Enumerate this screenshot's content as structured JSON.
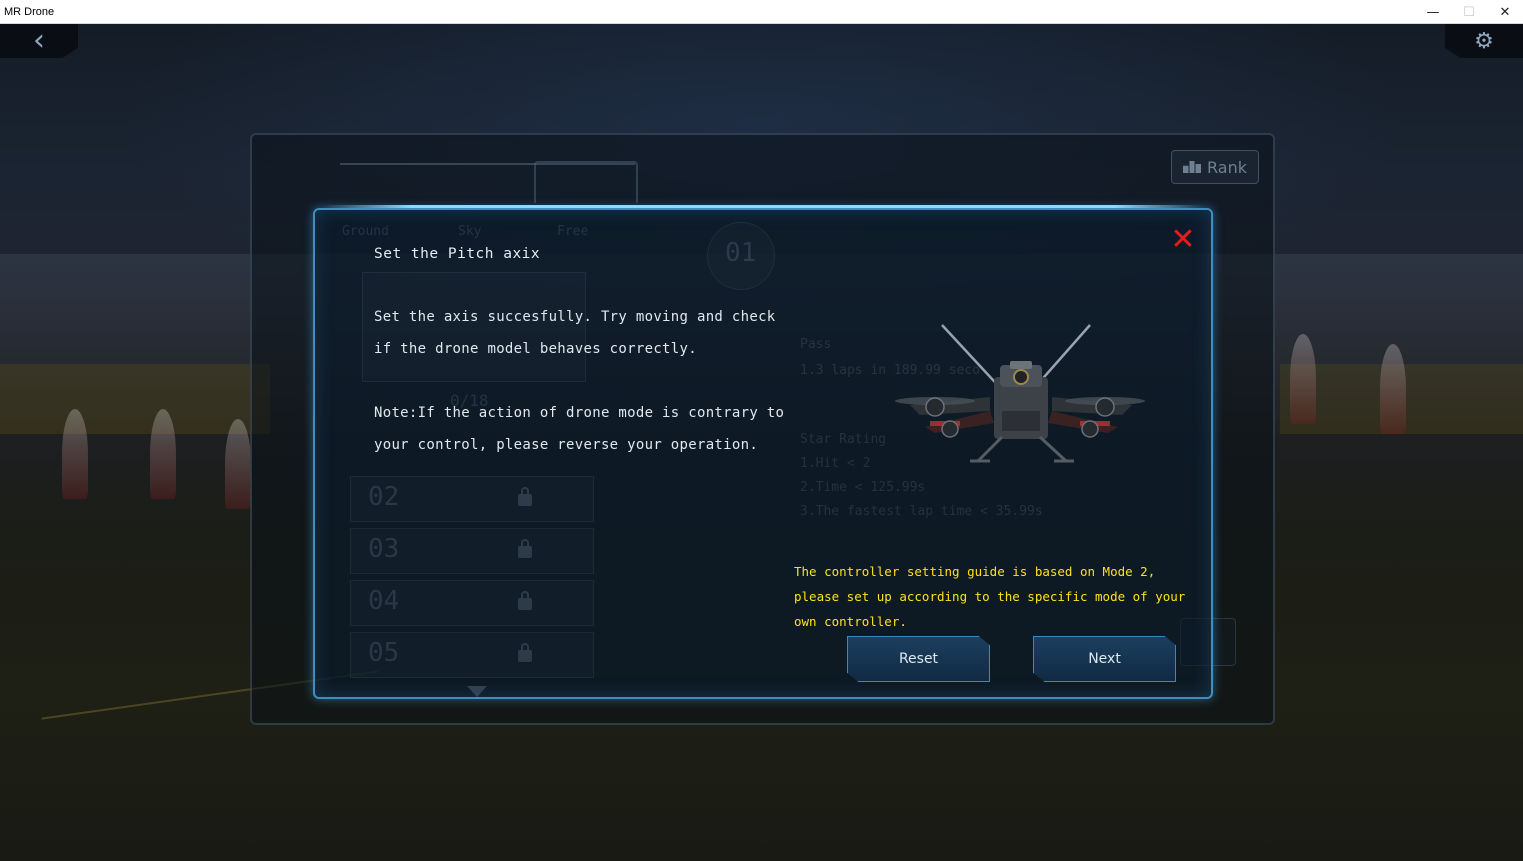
{
  "window": {
    "title": "MR Drone",
    "minimize_glyph": "—",
    "maximize_glyph": "☐",
    "close_glyph": "✕"
  },
  "scene": {
    "back_glyph": "‹",
    "settings_glyph": "⚙"
  },
  "background_panel": {
    "rank_label": "Rank",
    "tabs": [
      "Ground",
      "Sky",
      "Free"
    ],
    "progress": "0/18",
    "level_badge": "01",
    "levels": [
      "02",
      "03",
      "04",
      "05"
    ],
    "pass_heading": "Pass",
    "pass_text": "1.3 laps in 189.99 seco",
    "star_heading": "Star Rating",
    "star_items": [
      "1.Hit < 2",
      "2.Time < 125.99s",
      "3.The fastest lap time < 35.99s"
    ]
  },
  "dialog": {
    "title": "Set the Pitch axix",
    "body": "Set the axis succesfully. Try moving and check if the drone model behaves correctly.",
    "note": "Note:If the action of drone mode is contrary to your control, please reverse your operation.",
    "mode_notice": "The controller setting guide is based on Mode 2, please set up according to the specific mode of your own controller.",
    "close_glyph": "✕",
    "reset_label": "Reset",
    "next_label": "Next",
    "accent_color": "#3f8ec0",
    "notice_color": "#ffe11b",
    "close_color": "#e21d1d"
  }
}
